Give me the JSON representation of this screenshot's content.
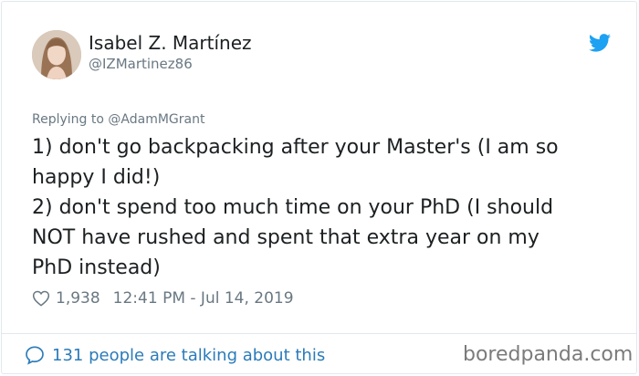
{
  "author": {
    "name": "Isabel Z. Martínez",
    "handle": "@IZMartinez86"
  },
  "reply": {
    "prefix": "Replying to",
    "to": "@AdamMGrant"
  },
  "tweet": {
    "lines": [
      "1) don't go backpacking after your Master's (I am so",
      "happy I did!)",
      "2) don't spend too much time on your PhD (I should",
      "NOT have rushed and spent that extra year on my",
      "PhD instead)"
    ]
  },
  "meta": {
    "likes": "1,938",
    "timestamp": "12:41 PM - Jul 14, 2019"
  },
  "footer": {
    "talking": "131 people are talking about this"
  },
  "watermark": "boredpanda.com",
  "icons": {
    "brand": "twitter-bird-icon",
    "like": "heart-icon",
    "conversation": "speech-bubble-icon"
  },
  "colors": {
    "twitter_blue": "#1da1f2",
    "link_blue": "#2b7bb9",
    "muted": "#697882",
    "text": "#1c2022"
  }
}
